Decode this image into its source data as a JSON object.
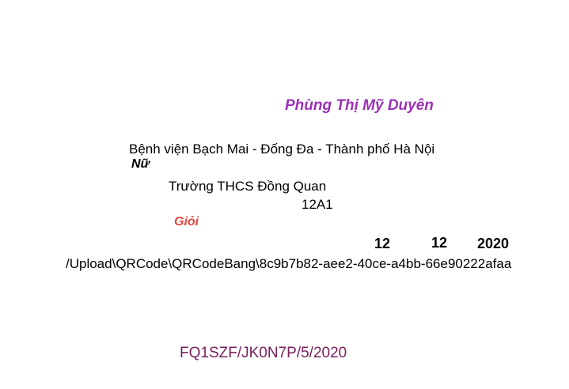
{
  "certificate": {
    "student_name": "Phùng Thị Mỹ Duyên",
    "birthplace": "Bệnh viện Bạch Mai - Đống Đa - Thành phố Hà Nội",
    "gender": "Nữ",
    "school": "Trường THCS Đồng Quan",
    "class_name": "12A1",
    "rank": "Giỏi",
    "date": {
      "day": "12",
      "month": "12",
      "year": "2020"
    },
    "qr_code_path": "/Upload\\QRCode\\QRCodeBang\\8c9b7b82-aee2-40ce-a4bb-66e90222afaa",
    "certificate_number": "FQ1SZF/JK0N7P/5/2020"
  },
  "colors": {
    "name": "#9b30b8",
    "rank": "#e8453c",
    "certificate_number": "#7a1f5c"
  }
}
